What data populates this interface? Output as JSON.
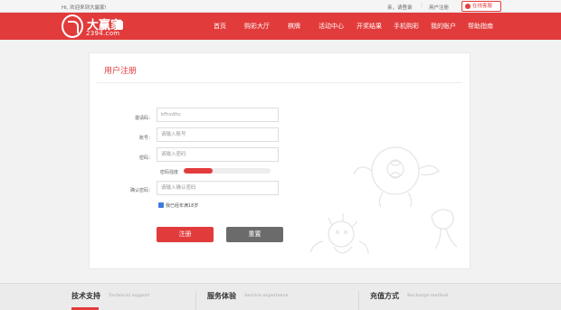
{
  "topbar": {
    "welcome": "Hi, 欢迎来到大赢家!",
    "login": "亲，请登录",
    "sep": "|",
    "register": "用户注册",
    "service": "在线客服"
  },
  "header": {
    "brand": "大赢家",
    "domain": "2394.com",
    "nav": [
      "首页",
      "购彩大厅",
      "棋牌",
      "活动中心",
      "开奖结果",
      "手机购彩",
      "我的账户",
      "帮助指南"
    ]
  },
  "form": {
    "title": "用户注册",
    "invite_label": "邀请码：",
    "invite_value": "kfhvdhc",
    "account_label": "账号：",
    "account_placeholder": "请输入账号",
    "password_label": "密码：",
    "password_placeholder": "请输入密码",
    "strength_label": "密码强度",
    "strength_level": 0.33,
    "confirm_label": "确认密码：",
    "confirm_placeholder": "请输入确认密码",
    "agree_text": "我已经年满18岁",
    "register_button": "注册",
    "reset_button": "重置"
  },
  "footer": {
    "col1_title": "技术支持",
    "col1_sub": "Technical support",
    "col2_title": "服务体验",
    "col2_sub": "Service experience",
    "col3_title": "充值方式",
    "col3_sub": "Recharge method"
  },
  "colors": {
    "brand": "#e23b3b",
    "reset": "#6b6b6b",
    "checkbox": "#3b7bd8"
  },
  "icons": {
    "service": "chat-bubble-icon",
    "logo": "brand-logo-mark",
    "mascot": "eight-ball-mascot-sketch"
  }
}
